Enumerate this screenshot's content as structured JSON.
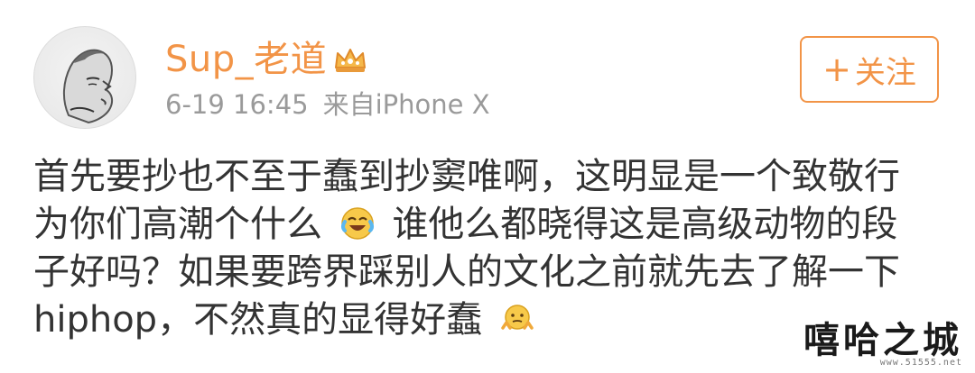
{
  "author": {
    "username": "Sup_老道",
    "badge_icon": "crown-icon",
    "avatar_icon": "avatar-portrait"
  },
  "meta": {
    "timestamp": "6-19 16:45",
    "source": "来自iPhone X"
  },
  "follow_button": {
    "plus": "+",
    "label": "关注",
    "color": "#f29447"
  },
  "post": {
    "lines": [
      "首先要抄也不至于蠢到抄窦唯啊，这明显是一个致敬行",
      "为你们高潮个什么",
      "谁他么都晓得这是高级动物的段",
      "子好吗？如果要跨界踩别人的文化之前就先去了解一下",
      "hiphop，不然真的显得好蠢"
    ],
    "emojis": [
      "laughing-crying-emoji",
      "shrug-emoji"
    ]
  },
  "watermark": {
    "text": "嘻哈之城",
    "url": "www.51555.net"
  }
}
